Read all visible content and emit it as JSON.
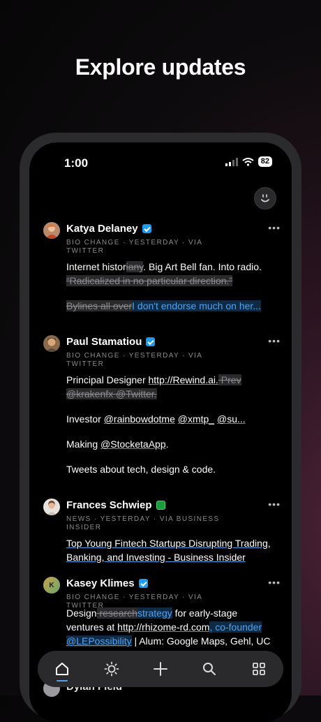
{
  "headline": "Explore updates",
  "status": {
    "time": "1:00",
    "battery": "82"
  },
  "cards": [
    {
      "name": "Katya Delaney",
      "meta": "BIO CHANGE · YESTERDAY · VIA TWITTER",
      "line1_a": "Internet histor",
      "line1_strike": "iany",
      "line1_b": ". Big Art Bell fan. Into radio.",
      "line2_strike": "“Radicalized in no particular direction.”",
      "line3_strike": "Bylines all over",
      "line3_added": "I don't endorse much on her..."
    },
    {
      "name": "Paul Stamatiou",
      "meta": "BIO CHANGE · YESTERDAY · VIA TWITTER",
      "l1_a": "Principal Designer ",
      "l1_link": "http://Rewind.ai.",
      "l1_strike": " Prev",
      "l2_strike": "@krakenfx @Twitter.",
      "l3_a": "Investor ",
      "l3_m1": "@rainbowdotme",
      "l3_m2": "@xmtp_",
      "l3_m3": "@su...",
      "l4_a": "Making ",
      "l4_m": "@StocketaApp",
      "l4_b": ".",
      "l5": "Tweets about tech, design & code."
    },
    {
      "name": "Frances Schwiep",
      "meta": "NEWS · YESTERDAY · VIA BUSINESS INSIDER",
      "headline": "Top Young Fintech Startups Disrupting Trading, Banking, and Investing - Business Insider"
    },
    {
      "name": "Kasey Klimes",
      "avatar_letter": "K",
      "meta": "BIO CHANGE · YESTERDAY · VIA TWITTER",
      "l1_a": "Design",
      "l1_strike": " research",
      "l1_added": "strategy",
      "l1_b": " for early-stage",
      "l2_a": "ventures at ",
      "l2_link": "http://rhizome-rd.com",
      "l2_added": ", co-founder",
      "l3_added": "@LEPossibility",
      "l3_b": " | Alum: Google Maps, Gehl, UC"
    }
  ],
  "partial_name": "Dylan Field",
  "more_label": "•••",
  "tabs": [
    "home-icon",
    "sun-icon",
    "plus-icon",
    "search-icon",
    "grid-icon"
  ]
}
